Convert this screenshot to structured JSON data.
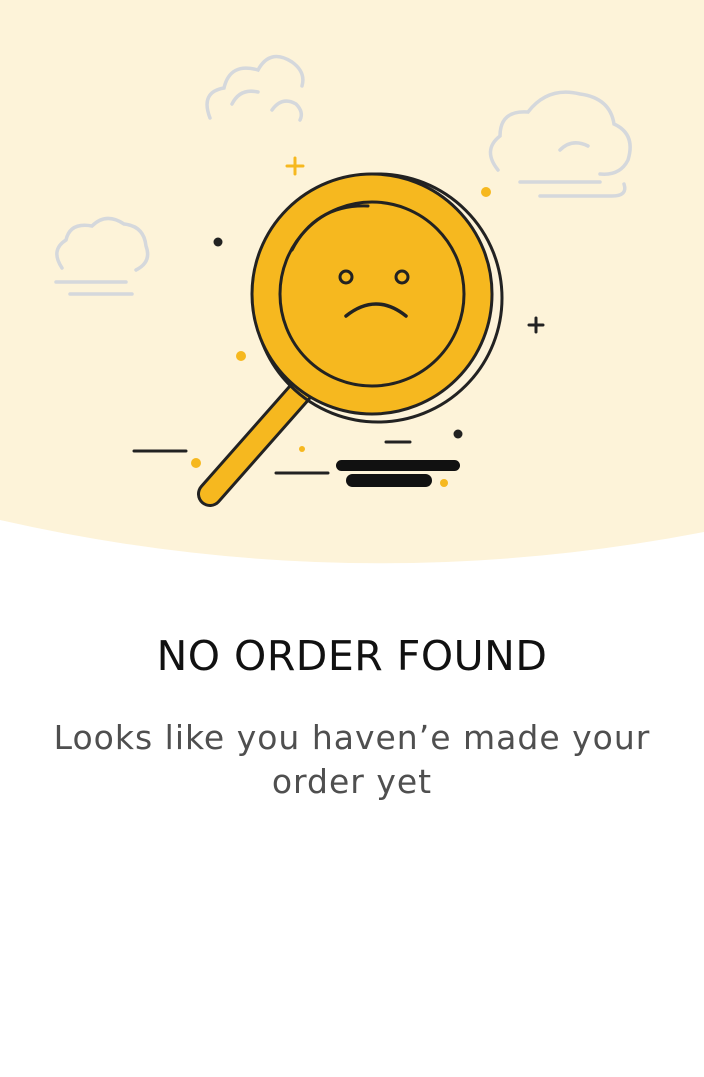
{
  "empty_state": {
    "illustration_icon": "sad-magnifying-glass-icon",
    "title": "NO ORDER FOUND",
    "message": "Looks like you haven’e made your order yet"
  },
  "colors": {
    "hero_background": "#fdf3d9",
    "accent_yellow": "#f6b81f",
    "cloud_outline": "#d5d8dc",
    "title_text": "#111111",
    "message_text": "#4f4f4f"
  }
}
